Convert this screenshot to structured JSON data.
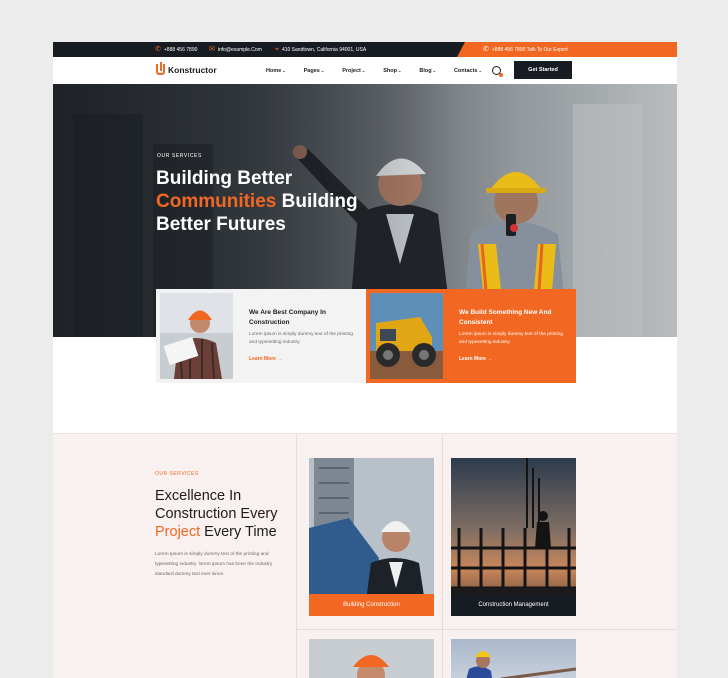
{
  "topbar": {
    "phone": "+888 456 7890",
    "email": "info@example.Com",
    "address": "410 Sandtown, California 94001, USA",
    "cta": "+888 456 7890 Talk To Our Expert"
  },
  "brand": {
    "name": "Konstructor"
  },
  "nav": {
    "items": [
      {
        "label": "Home"
      },
      {
        "label": "Pages"
      },
      {
        "label": "Project"
      },
      {
        "label": "Shop"
      },
      {
        "label": "Blog"
      },
      {
        "label": "Contacts"
      }
    ],
    "button": "Get Started"
  },
  "hero": {
    "tag": "OUR SERVICES",
    "title_line1": "Building Better",
    "title_accent": "Communities",
    "title_line2": " Building",
    "title_line3": "Better Futures"
  },
  "features": [
    {
      "title": "We Are Best Company In Construction",
      "text": "Lorem ipsum is simply dummy text of the printing and typesetting industry.",
      "link": "Learn More →"
    },
    {
      "title": "We Build Something New And Consistent",
      "text": "Lorem ipsum is simply dummy text of the printing and typesetting industry.",
      "link": "Learn More →"
    }
  ],
  "services": {
    "tag": "OUR SERVICES",
    "title_line1": "Excellence In",
    "title_line2": "Construction Every",
    "title_accent": "Project",
    "title_line3": " Every Time",
    "description": "Lorem Ipsum is simply dummy text of the printing and typesetting industry. lorem Ipsum has been the industry standard dummy text ever since.",
    "cards": [
      {
        "label": "Building Construction"
      },
      {
        "label": "Construction Management"
      }
    ]
  },
  "colors": {
    "accent": "#f26722",
    "dark": "#161c22"
  },
  "icons": [
    "phone-icon",
    "mail-icon",
    "location-icon",
    "search-icon",
    "arrow-right-icon"
  ]
}
